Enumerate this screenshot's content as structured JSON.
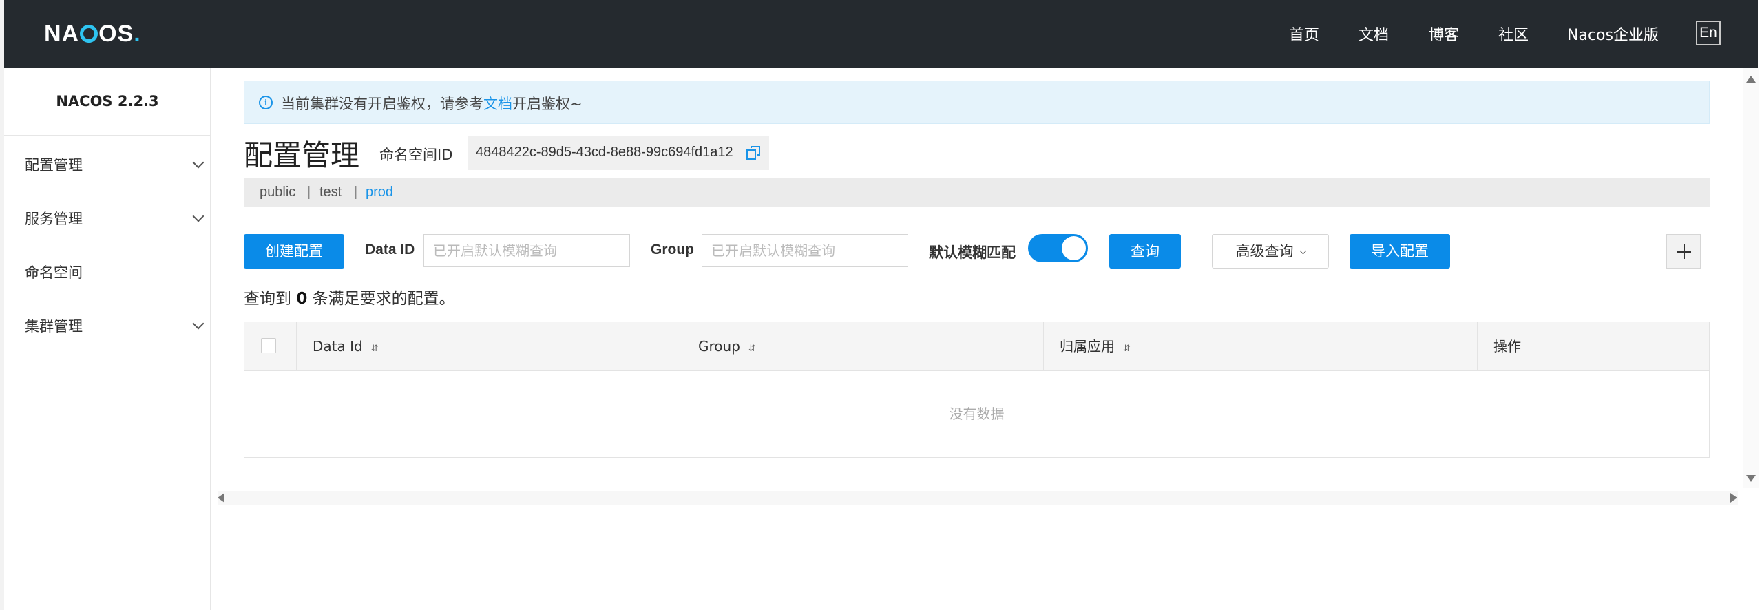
{
  "header": {
    "logo_text": "NACOS.",
    "nav": [
      "首页",
      "文档",
      "博客",
      "社区",
      "Nacos企业版"
    ],
    "lang_toggle": "En"
  },
  "sidebar": {
    "version": "NACOS 2.2.3",
    "items": [
      {
        "label": "配置管理",
        "expandable": true
      },
      {
        "label": "服务管理",
        "expandable": true
      },
      {
        "label": "命名空间",
        "expandable": false
      },
      {
        "label": "集群管理",
        "expandable": true
      }
    ]
  },
  "notice": {
    "prefix": "当前集群没有开启鉴权，请参考",
    "link": "文档",
    "suffix": "开启鉴权~"
  },
  "page": {
    "title": "配置管理",
    "namespace_label": "命名空间ID",
    "namespace_id": "4848422c-89d5-43cd-8e88-99c694fd1a12"
  },
  "namespaces": {
    "tabs": [
      "public",
      "test",
      "prod"
    ],
    "separator": "|",
    "active": "prod"
  },
  "toolbar": {
    "create_label": "创建配置",
    "data_id_label": "Data ID",
    "data_id_placeholder": "已开启默认模糊查询",
    "group_label": "Group",
    "group_placeholder": "已开启默认模糊查询",
    "fuzzy_label": "默认模糊匹配",
    "fuzzy_enabled": true,
    "query_label": "查询",
    "advanced_label": "高级查询",
    "import_label": "导入配置"
  },
  "result": {
    "prefix": "查询到",
    "count": "0",
    "suffix": "条满足要求的配置。"
  },
  "table": {
    "columns": [
      "Data Id",
      "Group",
      "归属应用",
      "操作"
    ],
    "sort_icon": "⇵",
    "rows": [],
    "empty_text": "没有数据"
  },
  "colors": {
    "header_bg": "#252a2f",
    "primary": "#0a8be8",
    "link": "#1a94e8",
    "notice_bg": "#e5f3fb"
  }
}
